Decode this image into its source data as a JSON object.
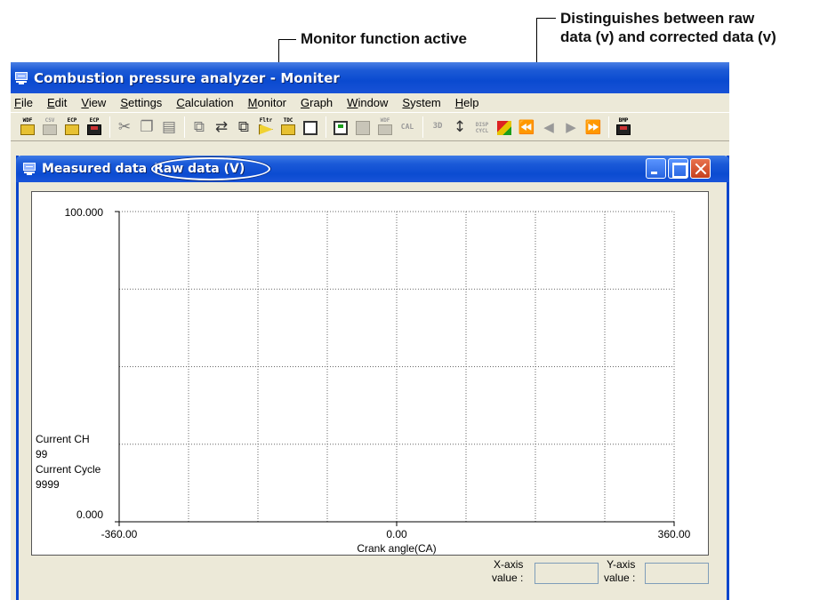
{
  "annotations": {
    "monitor_callout": "Monitor function active",
    "raw_callout_line1": "Distinguishes between raw",
    "raw_callout_line2": "data (v) and corrected data (v)"
  },
  "app": {
    "title": "Combustion pressure analyzer - Moniter",
    "menu": [
      "File",
      "Edit",
      "View",
      "Settings",
      "Calculation",
      "Monitor",
      "Graph",
      "Window",
      "System",
      "Help"
    ]
  },
  "toolbar": {
    "captions": {
      "wdf_open": "WDF",
      "csv": "CSV",
      "ecp_open": "ECP",
      "ecp_save": "ECP",
      "filter": "Fltr",
      "tdc": "TDC",
      "wdf_gray": "WDF",
      "cal": "CAL",
      "three_d": "3D",
      "disp_cycl_1": "DISP",
      "disp_cycl_2": "CYCL",
      "bmp": "BMP"
    },
    "icons": [
      "open-wdf-icon",
      "save-csv-icon",
      "open-ecp-icon",
      "save-ecp-icon",
      "cut-icon",
      "copy-icon",
      "paste-icon",
      "window-icon",
      "compare-icon",
      "windows-icon",
      "filter-icon",
      "tdc-icon",
      "list-icon",
      "graph-window-icon",
      "graph-gray-icon",
      "wdf-gray-icon",
      "cal-icon",
      "three-d-icon",
      "axis-icon",
      "display-cycle-icon",
      "color-icon",
      "first-icon",
      "prev-icon",
      "next-icon",
      "last-icon",
      "save-bmp-icon"
    ]
  },
  "child_window": {
    "title": "Measured data",
    "mode": "Raw data (V)"
  },
  "chart_data": {
    "type": "line",
    "series": [],
    "x_ticks": [
      "-360.00",
      "0.00",
      "360.00"
    ],
    "y_ticks": [
      "100.000",
      "0.000"
    ],
    "xlim": [
      -360,
      360
    ],
    "ylim": [
      0,
      100
    ],
    "xlabel": "Crank angle(CA)",
    "ylabel": "",
    "grid": true,
    "grid_x_divisions": 8,
    "grid_y_divisions": 4
  },
  "info": {
    "current_ch_label": "Current CH",
    "current_ch_value": "99",
    "current_cycle_label": "Current Cycle",
    "current_cycle_value": "9999"
  },
  "readouts": {
    "x_label_1": "X-axis",
    "x_label_2": "value :",
    "x_value": "",
    "y_label_1": "Y-axis",
    "y_label_2": "value :",
    "y_value": ""
  }
}
